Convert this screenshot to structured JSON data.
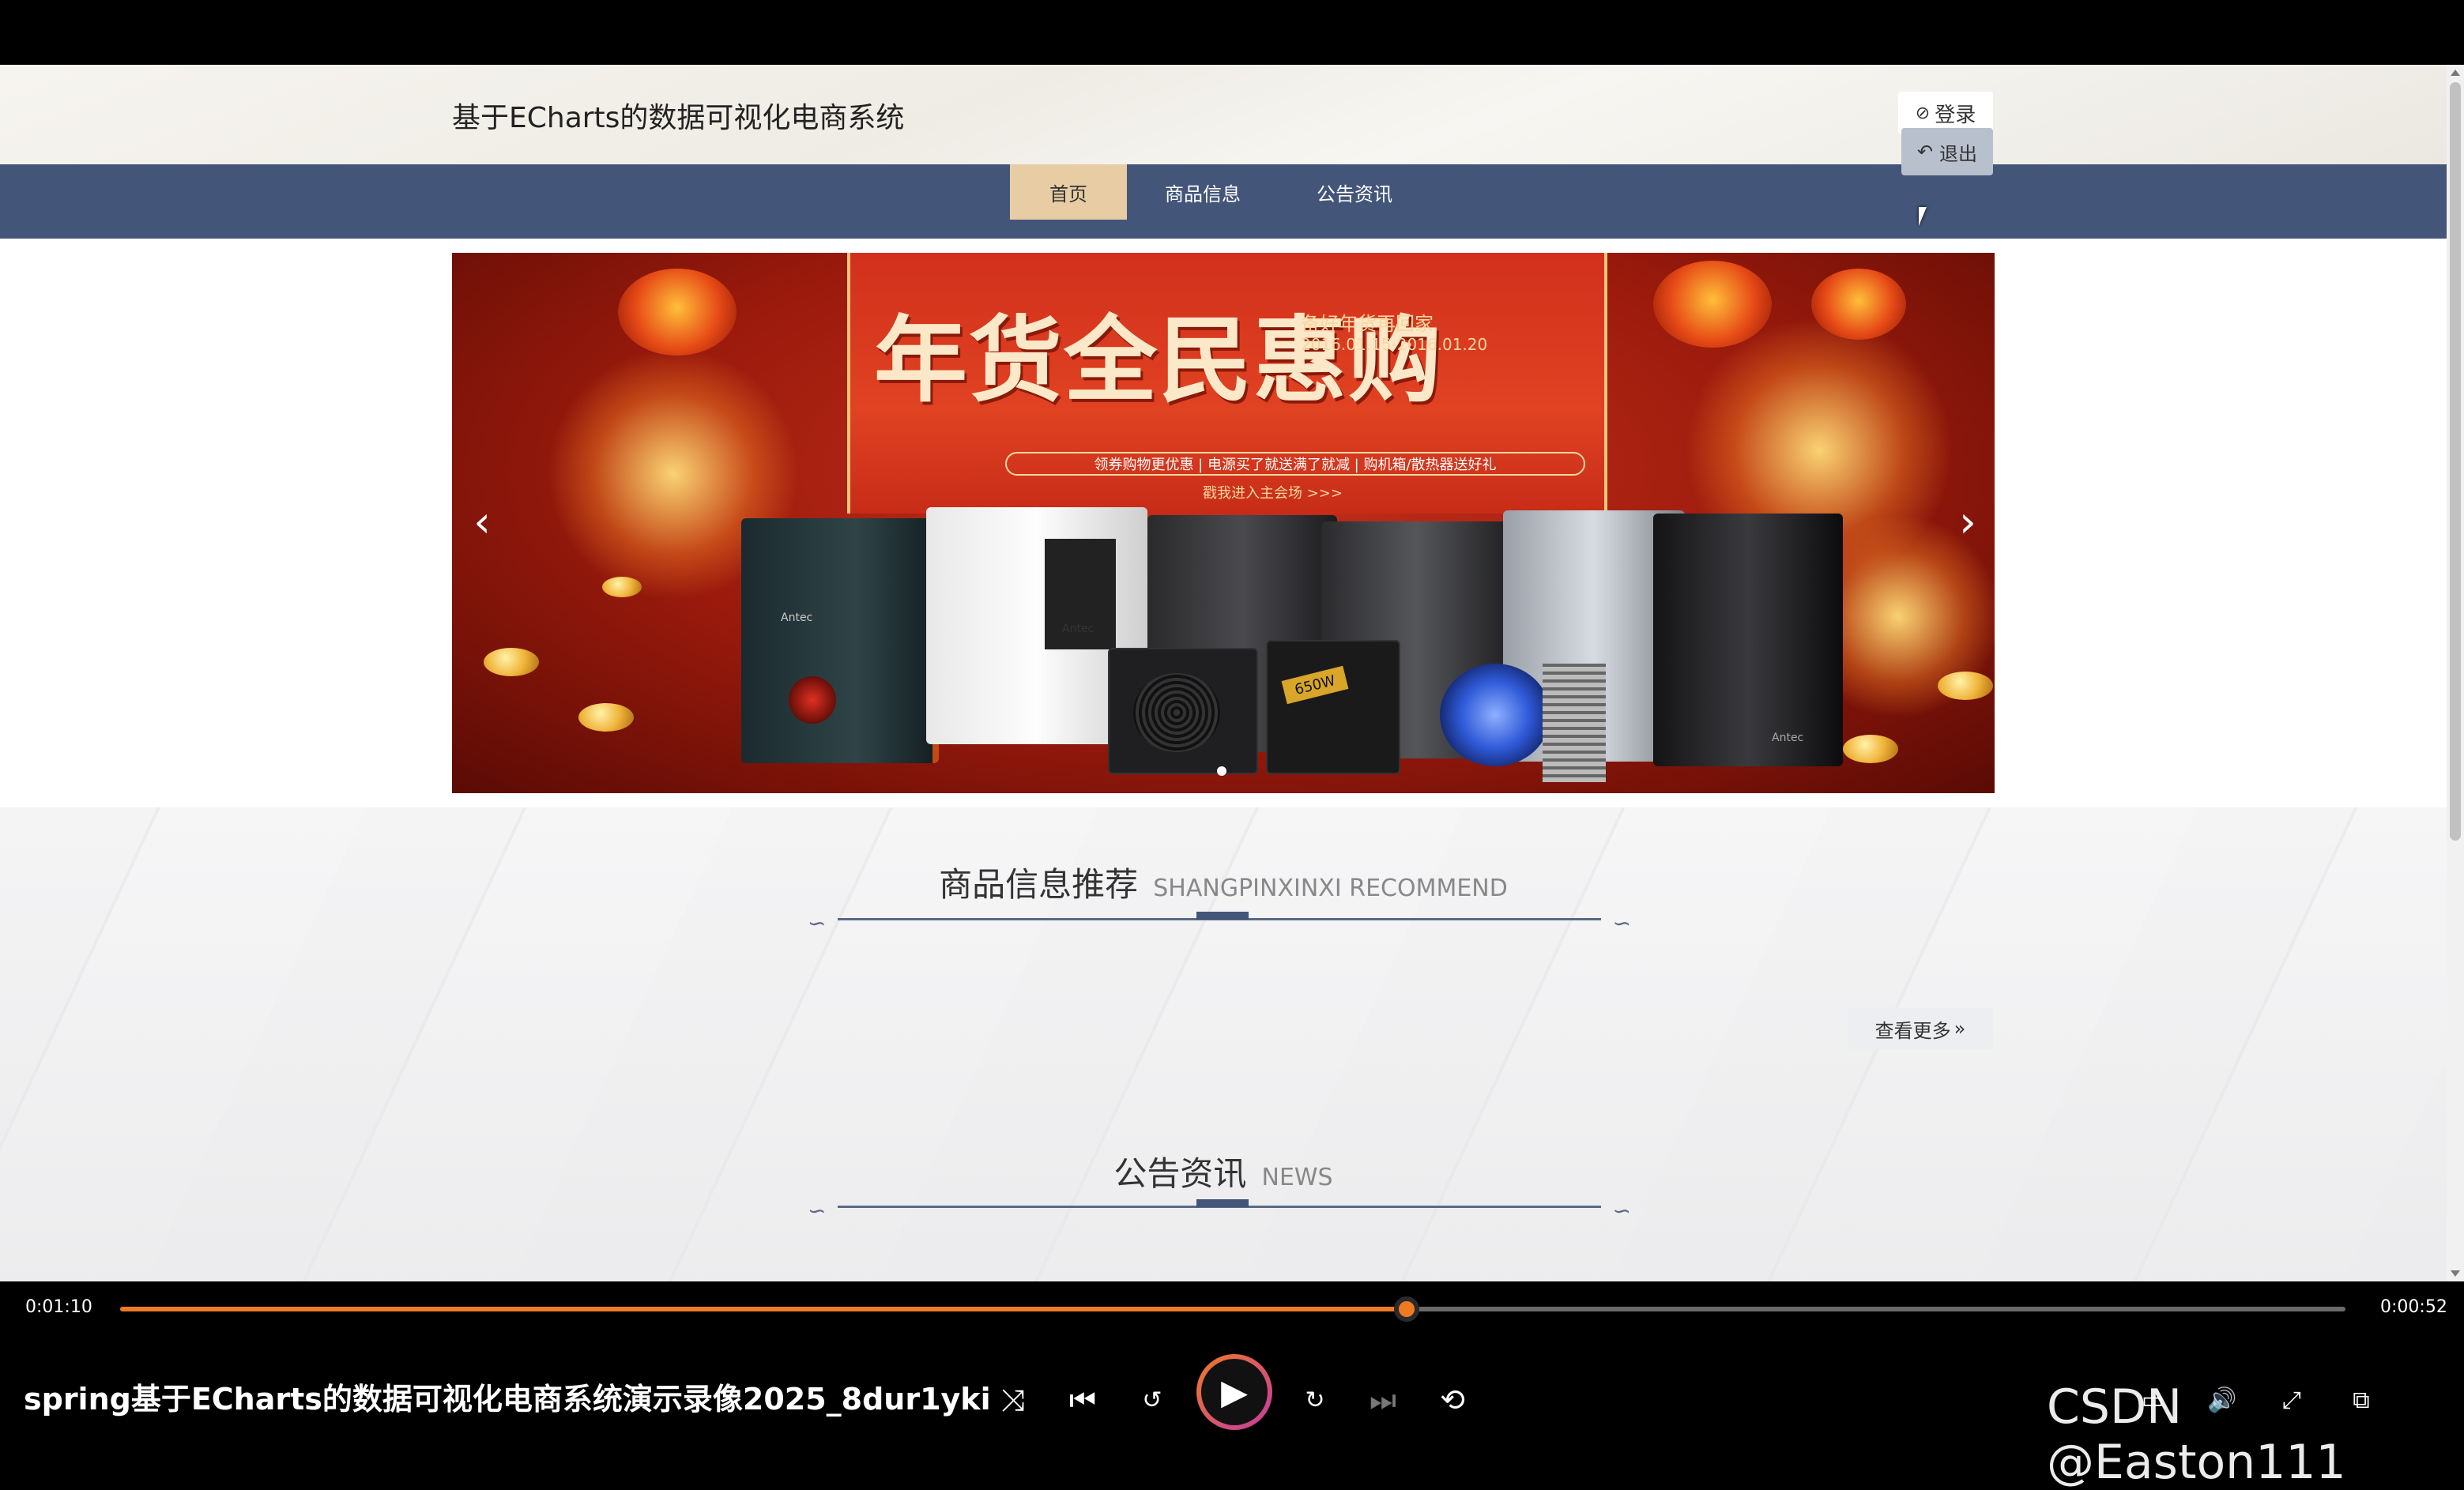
{
  "header": {
    "site_title": "基于ECharts的数据可视化电商系统",
    "login_label": "登录",
    "login_icon": "check-circle-icon"
  },
  "nav": {
    "tabs": [
      {
        "label": "首页",
        "active": true
      },
      {
        "label": "商品信息",
        "active": false
      },
      {
        "label": "公告资讯",
        "active": false
      }
    ],
    "logout_label": "退出",
    "logout_icon": "undo-icon",
    "color": "#435579",
    "active_color": "#e8cda4"
  },
  "banner": {
    "headline": "年货全民惠购",
    "subtitle": "备好年货再回家",
    "date_range": "2016.01.15-2016.01.20",
    "strip": "领券购物更优惠 | 电源买了就送满了就减 | 购机箱/散热器送好礼",
    "enter": "戳我进入主会场 >>>",
    "brand": "Antec",
    "psu_label": "650W",
    "prev_icon": "chevron-left-icon",
    "next_icon": "chevron-right-icon"
  },
  "sections": {
    "products": {
      "zh": "商品信息推荐",
      "en": "SHANGPINXINXI RECOMMEND",
      "more": "查看更多"
    },
    "news": {
      "zh": "公告资讯",
      "en": "NEWS"
    }
  },
  "player": {
    "elapsed": "0:01:10",
    "remaining": "0:00:52",
    "progress": 0.578,
    "title": "spring基于ECharts的数据可视化电商系统演示录像2025_8dur1yki",
    "accent": "#f07a24"
  },
  "watermark": "CSDN @Easton111"
}
